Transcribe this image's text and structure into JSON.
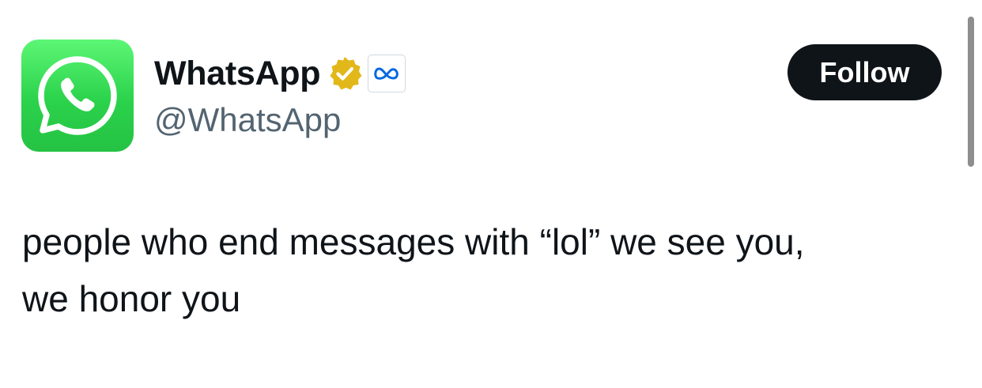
{
  "author": {
    "display_name": "WhatsApp",
    "handle": "@WhatsApp",
    "avatar_icon": "whatsapp-logo-icon",
    "verified_icon": "verified-badge-icon",
    "affiliate_icon": "meta-logo-icon"
  },
  "follow_button": {
    "label": "Follow"
  },
  "tweet": {
    "text": "people who end messages with “lol” we see you,\nwe honor you"
  },
  "colors": {
    "avatar_green": "#2bd24b",
    "verified_gold": "#e2b719",
    "meta_blue": "#0668e1",
    "follow_bg": "#0f1419",
    "handle_gray": "#536471"
  }
}
